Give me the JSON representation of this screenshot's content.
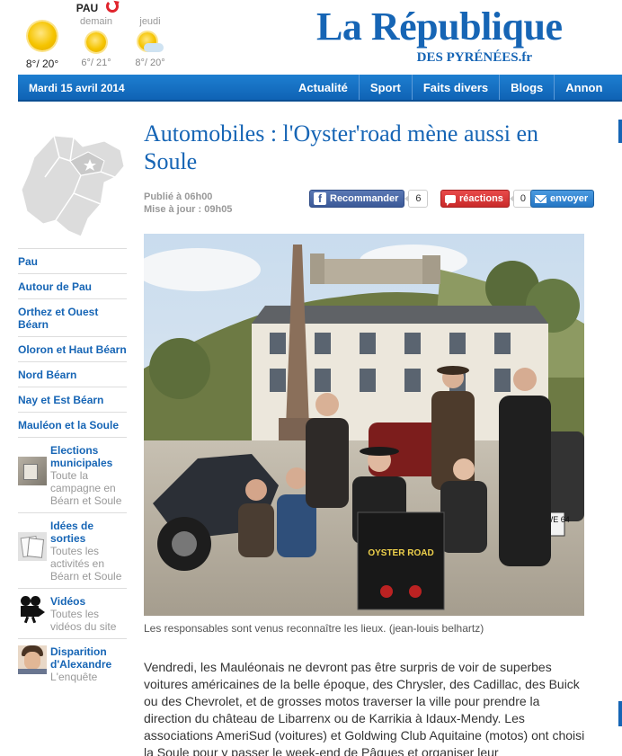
{
  "weather": {
    "city": "PAU",
    "today_temp": "8°/ 20°",
    "tomorrow_label": "demain",
    "tomorrow_temp": "6°/ 21°",
    "day3_label": "jeudi",
    "day3_temp": "8°/ 20°",
    "icons": [
      "sun-icon",
      "sun-icon",
      "sun-cloud-icon"
    ],
    "accent_color": "#e0242d"
  },
  "logo": {
    "main": "La République",
    "sub": "DES PYRÉNÉES.fr",
    "brand_color": "#1665b5"
  },
  "nav": {
    "date": "Mardi 15 avril 2014",
    "items": [
      "Actualité",
      "Sport",
      "Faits divers",
      "Blogs",
      "Annon"
    ]
  },
  "sidebar": {
    "items": [
      "Pau",
      "Autour de Pau",
      "Orthez et Ouest Béarn",
      "Oloron et Haut Béarn",
      "Nord Béarn",
      "Nay et Est Béarn",
      "Mauléon et la Soule"
    ],
    "features": [
      {
        "title": "Elections municipales",
        "desc": "Toute la campagne en Béarn et Soule",
        "icon": "ballot-box-icon"
      },
      {
        "title": "Idées de sorties",
        "desc": "Toutes les activités en Béarn et Soule",
        "icon": "documents-icon"
      },
      {
        "title": "Vidéos",
        "desc": "Toutes les vidéos du site",
        "icon": "film-camera-icon"
      },
      {
        "title": "Disparition d'Alexandre",
        "desc": "L'enquête",
        "icon": "portrait-icon"
      }
    ]
  },
  "article": {
    "headline": "Automobiles : l'Oyster'road mène aussi en Soule",
    "published": "Publié à 06h00",
    "updated": "Mise à jour : 09h05",
    "share": {
      "facebook_label": "Recommander",
      "facebook_count": "6",
      "reactions_label": "réactions",
      "reactions_count": "0",
      "email_label": "envoyer"
    },
    "caption": "Les responsables sont venus reconnaître les lieux. (jean-louis belhartz)",
    "body": "Vendredi, les Mauléonais ne devront pas être surpris de voir de superbes voitures américaines de la belle époque, des Chrysler, des Cadillac, des Buick ou des Chevrolet, et de grosses motos traverser la ville pour prendre la direction du château de Libarrenx ou de Karrikia à Idaux-Mendy. Les associations AmeriSud (voitures) et Goldwing Club Aquitaine (motos) ont choisi la Soule pour y passer le week-end de Pâques et organiser leur"
  },
  "photo": {
    "poster_title": "OYSTER ROAD",
    "plate": "6583 WE 64"
  }
}
